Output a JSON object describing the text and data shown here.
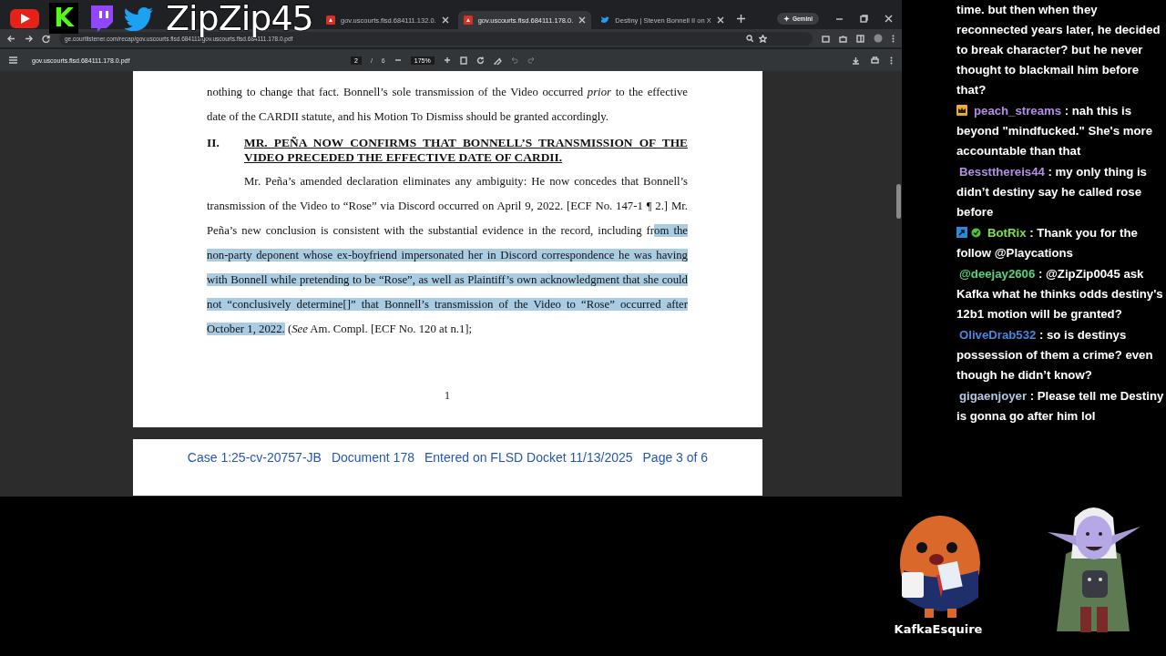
{
  "overlay": {
    "logos": [
      {
        "kind": "youtube"
      },
      {
        "kind": "kick",
        "text": "K"
      },
      {
        "kind": "twitch"
      },
      {
        "kind": "twitter"
      }
    ],
    "channel_name": "ZipZip45"
  },
  "browser": {
    "tabs": [
      {
        "title": "gov.uscourts.flsd.684111.132.0.",
        "kind": "pdf",
        "selected": false
      },
      {
        "title": "gov.uscourts.flsd.684111.178.0.",
        "kind": "pdf",
        "selected": true
      },
      {
        "title": "Destiny | Steven Bonnell II on X",
        "kind": "social",
        "selected": false
      }
    ],
    "gemini_label": "Gemini",
    "url": "ge.courtlistener.com/recap/gov.uscourts.flsd.684111/gov.uscourts.flsd.684111.178.0.pdf",
    "pdf_toolbar": {
      "file_name": "gov.uscourts.flsd.684111.178.0.pdf",
      "current_page": "2",
      "page_separator": "/",
      "page_count": "6",
      "zoom": "175%"
    },
    "document": {
      "blocks": [
        {
          "kind": "continued_paragraph",
          "segments": [
            {
              "text": "nothing to change that fact. Bonnell’s sole transmission of the Video occurred *prior* to the effective date of the CARDII statute, and his Motion To Dismiss should be granted accordingly.",
              "selected": false
            }
          ]
        },
        {
          "kind": "heading",
          "number": "II.",
          "text": "MR. PEÑA NOW CONFIRMS THAT BONNELL’S TRANSMISSION OF THE VIDEO PRECEDED THE EFFECTIVE DATE OF CARDII."
        },
        {
          "kind": "paragraph",
          "segments": [
            {
              "text": "Mr. Peña’s amended declaration eliminates any ambiguity: He now concedes that Bonnell’s transmission of the Video to “Rose” via Discord occurred on April 9, 2022. [ECF No. 147-1 ¶ 2.] Mr. Peña’s new conclusion is consistent with the substantial evidence in the record, including fr",
              "selected": false
            },
            {
              "text": "om the non-party deponent whose ex-boyfriend impersonated her in Discord correspondence he was having with Bonnell while pretending to be “Rose”, as well as Plaintiff’s own acknowledgment that she could not “conclusively determine[]” that Bonnell’s transmission of the Video to “Rose” occurred after October 1, 2022.",
              "selected": true
            },
            {
              "text": " (*See* Am. Compl. [ECF No. 120 at n.1];",
              "selected": false
            }
          ]
        }
      ],
      "page_number": "1",
      "next_page_footer": [
        "Case 1:25-cv-20757-JB",
        "Document 178",
        "Entered on FLSD Docket 11/13/2025",
        "Page 3 of 6"
      ]
    }
  },
  "chat": {
    "messages": [
      {
        "text": "time. but then when they reconnected years later, he decided to break character? but he never thought to blackmail him before that?"
      },
      {
        "user": "peach_streams",
        "color": "#b48ee6",
        "badges": [
          {
            "kind": "crown"
          }
        ],
        "text": ": nah this is beyond \"mindfucked.\" She's more accountable than that"
      },
      {
        "user": "Besstthereis44",
        "color": "#b48ee6",
        "text": ": my only thing is didn’t destiny say he called rose before"
      },
      {
        "user": "BotRix",
        "color": "#7ee04c",
        "badges": [
          {
            "kind": "bot"
          },
          {
            "kind": "verified"
          }
        ],
        "text": ": Thank you for the follow @Playcations"
      },
      {
        "user": "@deejay2606",
        "color": "#52d67e",
        "text": ": @ZipZip0045 ask Kafka what he thinks odds destiny's 12b1 motion will be granted?"
      },
      {
        "user": "OliveDrab532",
        "color": "#4a86e0",
        "text": ": so is destinys possession of them a crime? even though he didn’t know?"
      },
      {
        "user": "gigaenjoyer",
        "color": "#b7c6e0",
        "text": ": Please tell me Destiny is gonna go after him lol"
      }
    ]
  },
  "mascots": {
    "label": "KafkaEsquire"
  }
}
